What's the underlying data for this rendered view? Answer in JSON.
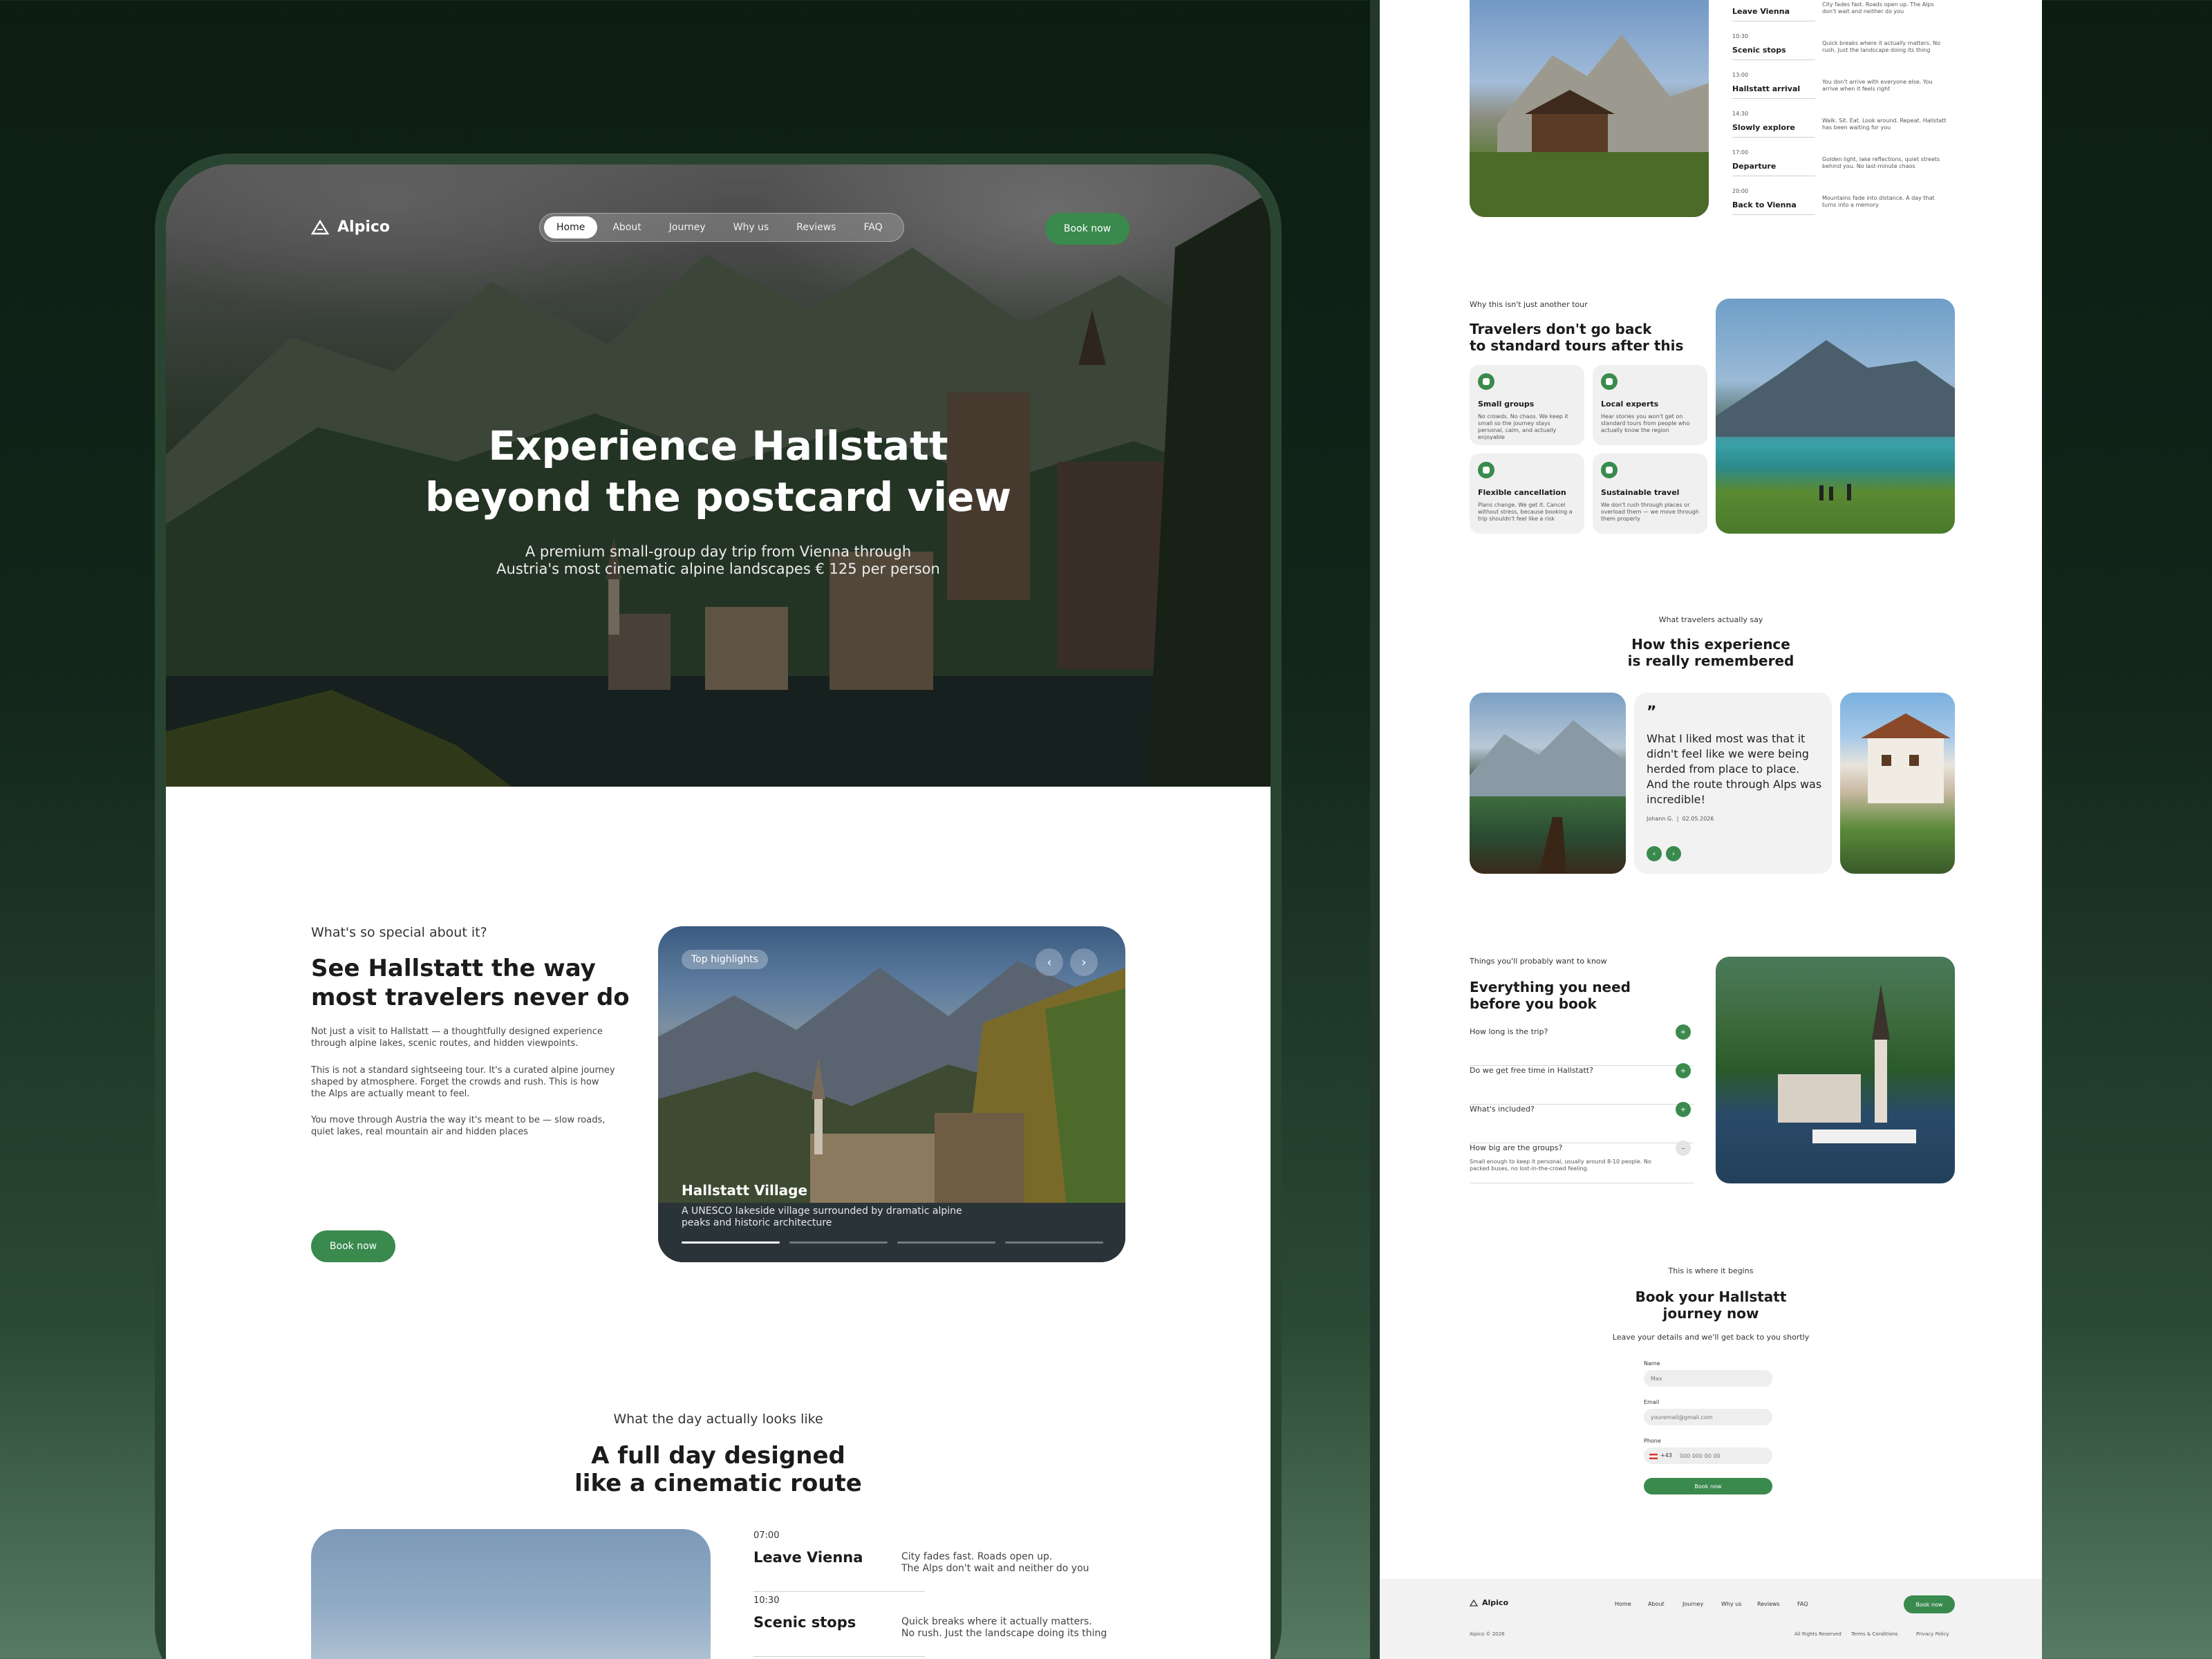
{
  "brand": {
    "name": "Alpico",
    "accent": "#3a8a4e"
  },
  "nav": {
    "items": [
      "Home",
      "About",
      "Journey",
      "Why us",
      "Reviews",
      "FAQ"
    ],
    "book_label": "Book now"
  },
  "hero": {
    "title_line1": "Experience Hallstatt",
    "title_line2": "beyond the postcard view",
    "sub_line1": "A premium small-group day trip from Vienna through",
    "sub_line2": "Austria's most cinematic alpine landscapes € 125 per person"
  },
  "special": {
    "eyebrow": "What's so special about it?",
    "title_line1": "See Hallstatt the way",
    "title_line2": "most travelers never do",
    "p1": "Not just a visit to Hallstatt — a thoughtfully designed experience through alpine lakes, scenic routes, and hidden viewpoints.",
    "p2": "This is not a standard sightseeing tour. It's a curated alpine journey shaped by atmosphere. Forget the crowds and rush. This is how the Alps are actually meant to feel.",
    "p3": "You move through Austria the way it's meant to be — slow roads, quiet lakes, real mountain air and hidden places",
    "book_label": "Book now",
    "slider": {
      "tag": "Top highlights",
      "prev": "‹",
      "next": "›",
      "caption_title": "Hallstatt Village",
      "caption_sub": "A UNESCO lakeside village surrounded by dramatic alpine peaks and historic architecture"
    }
  },
  "day": {
    "eyebrow": "What the day actually looks like",
    "title_line1": "A full day designed",
    "title_line2": "like a cinematic route",
    "timeline": [
      {
        "time": "07:00",
        "name": "Leave Vienna",
        "desc1": "City fades fast. Roads open up.",
        "desc2": "The Alps don't wait and neither do you"
      },
      {
        "time": "10:30",
        "name": "Scenic stops",
        "desc1": "Quick breaks where it actually matters.",
        "desc2": "No rush. Just the landscape doing its thing"
      }
    ]
  },
  "right": {
    "timeline": [
      {
        "time": "",
        "name": "Leave Vienna",
        "desc": "City fades fast. Roads open up. The Alps don't wait and neither do you"
      },
      {
        "time": "10:30",
        "name": "Scenic stops",
        "desc": "Quick breaks where it actually matters. No rush. Just the landscape doing its thing"
      },
      {
        "time": "13:00",
        "name": "Hallstatt arrival",
        "desc": "You don't arrive with everyone else. You arrive when it feels right"
      },
      {
        "time": "14:30",
        "name": "Slowly explore",
        "desc": "Walk. Sit. Eat. Look around. Repeat. Hallstatt has been waiting for you"
      },
      {
        "time": "17:00",
        "name": "Departure",
        "desc": "Golden light, lake reflections, quiet streets behind you. No last-minute chaos"
      },
      {
        "time": "20:00",
        "name": "Back to Vienna",
        "desc": "Mountains fade into distance. A day that turns into a memory"
      }
    ],
    "why": {
      "eyebrow": "Why this isn't just another tour",
      "title_line1": "Travelers don't go back",
      "title_line2": "to standard tours after this",
      "cards": [
        {
          "title": "Small groups",
          "desc": "No crowds. No chaos. We keep it small so the journey stays personal, calm, and actually enjoyable",
          "icon": "group-icon"
        },
        {
          "title": "Local experts",
          "desc": "Hear stories you won't get on standard tours from people who actually know the region",
          "icon": "expert-icon"
        },
        {
          "title": "Flexible cancellation",
          "desc": "Plans change. We get it. Cancel without stress, because booking a trip shouldn't feel like a risk",
          "icon": "cancel-icon"
        },
        {
          "title": "Sustainable travel",
          "desc": "We don't rush through places or overload them — we move through them properly",
          "icon": "leaf-icon"
        }
      ]
    },
    "reviews": {
      "eyebrow": "What travelers actually say",
      "title_line1": "How this experience",
      "title_line2": "is really remembered",
      "quote_mark": "”",
      "quote": "What I liked most was that it didn't feel like we were being herded from place to place. And the route through Alps was incredible!",
      "author": "Johann G.",
      "date": "02.05.2026",
      "prev": "‹",
      "next": "›"
    },
    "faq": {
      "eyebrow": "Things you'll probably want to know",
      "title_line1": "Everything you need",
      "title_line2": "before you book",
      "items": [
        {
          "q": "How long is the trip?",
          "icon": "+"
        },
        {
          "q": "Do we get free time in Hallstatt?",
          "icon": "+"
        },
        {
          "q": "What's included?",
          "icon": "+"
        },
        {
          "q": "How big are the groups?",
          "icon": "–",
          "a": "Small enough to keep it personal, usually around 8-10 people. No packed buses, no lost-in-the-crowd feeling."
        }
      ]
    },
    "booking": {
      "eyebrow": "This is where it begins",
      "title_line1": "Book your Hallstatt",
      "title_line2": "journey now",
      "sub": "Leave your details and we'll get back to you shortly",
      "name_label": "Name",
      "name_ph": "Max",
      "email_label": "Email",
      "email_ph": "youremail@gmail.com",
      "phone_label": "Phone",
      "phone_code": "+43",
      "phone_ph": "000 000 00 00",
      "submit": "Book now"
    },
    "footer": {
      "brand": "Alpico",
      "nav": [
        "Home",
        "About",
        "Journey",
        "Why us",
        "Reviews",
        "FAQ"
      ],
      "book": "Book now",
      "copyright": "Alpico © 2026",
      "legal": [
        "All Rights Reserved",
        "Terms & Conditions",
        "Privacy Policy"
      ]
    }
  }
}
